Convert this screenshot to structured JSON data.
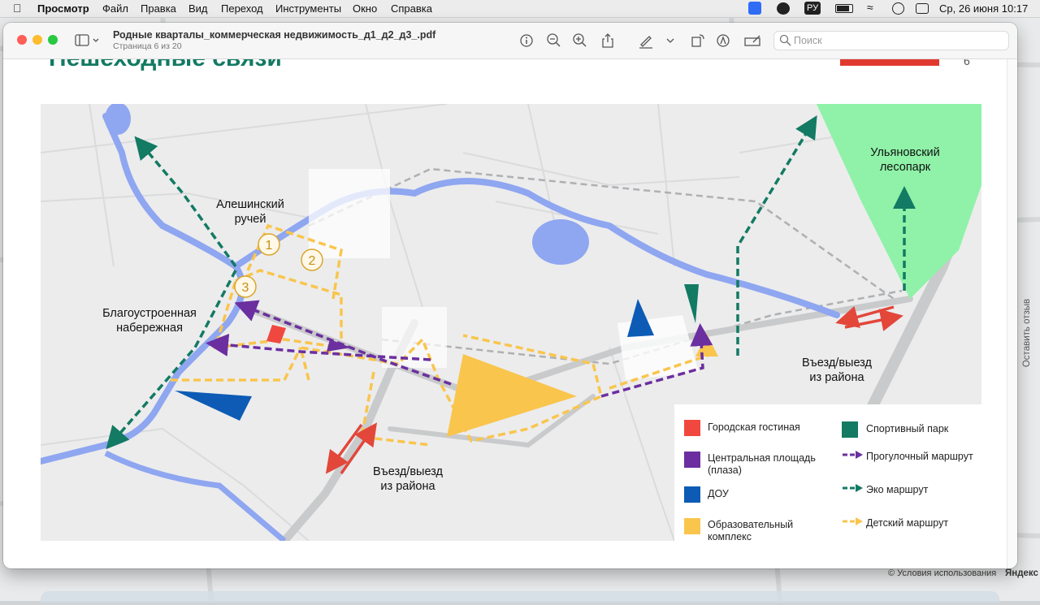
{
  "menubar": {
    "app": "Просмотр",
    "items": [
      "Файл",
      "Правка",
      "Вид",
      "Переход",
      "Инструменты",
      "Окно",
      "Справка"
    ],
    "input_lang": "РУ",
    "datetime": "Ср, 26 июня  10:17"
  },
  "window": {
    "title": "Родные кварталы_коммерческая недвижимость_д1_д2_д3_.pdf",
    "subtitle": "Страница 6 из 20",
    "search_placeholder": "Поиск"
  },
  "page": {
    "heading": "Пешеходные связи",
    "page_number": "6"
  },
  "map": {
    "labels": {
      "stream": "Алешинский ручей",
      "embankment": "Благоустроенная набережная",
      "forest": "Ульяновский лесопарк",
      "entry_east": "Въезд/выезд из района",
      "entry_south": "Въезд/выезд из района"
    },
    "plot_numbers": [
      "1",
      "2",
      "3"
    ]
  },
  "legend": {
    "items": [
      {
        "label": "Городская гостиная",
        "color": "#f0483e",
        "kind": "square"
      },
      {
        "label": "Центральная площадь (плаза)",
        "color": "#6b2fa0",
        "kind": "square"
      },
      {
        "label": "ДОУ",
        "color": "#0d5bb5",
        "kind": "square"
      },
      {
        "label": "Образовательный комплекс",
        "color": "#f9c54c",
        "kind": "square"
      },
      {
        "label": "Спортивный парк",
        "color": "#137a63",
        "kind": "square"
      },
      {
        "label": "Прогулочный маршрут",
        "color": "#6b2fa0",
        "kind": "arrow"
      },
      {
        "label": "Эко маршрут",
        "color": "#137a63",
        "kind": "arrow"
      },
      {
        "label": "Детский маршрут",
        "color": "#f9c54c",
        "kind": "arrow"
      }
    ]
  },
  "side": {
    "feedback": "Оставить отзыв",
    "terms": "© Условия использования",
    "brand": "Яндекс"
  },
  "colors": {
    "water": "#8fa6f0",
    "forest": "#8ff2a8",
    "heading": "#137a63",
    "red_bar": "#e03a30"
  }
}
